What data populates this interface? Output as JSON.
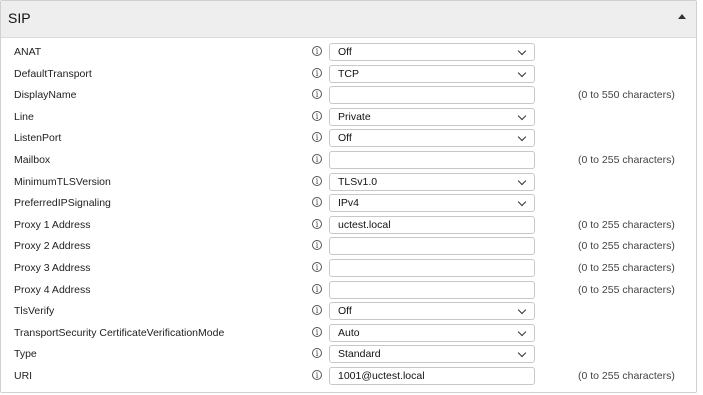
{
  "panel": {
    "title": "SIP"
  },
  "rows": [
    {
      "label": "ANAT",
      "type": "select",
      "value": "Off",
      "hint": ""
    },
    {
      "label": "DefaultTransport",
      "type": "select",
      "value": "TCP",
      "hint": ""
    },
    {
      "label": "DisplayName",
      "type": "text",
      "value": "",
      "hint": "(0 to 550 characters)"
    },
    {
      "label": "Line",
      "type": "select",
      "value": "Private",
      "hint": ""
    },
    {
      "label": "ListenPort",
      "type": "select",
      "value": "Off",
      "hint": ""
    },
    {
      "label": "Mailbox",
      "type": "text",
      "value": "",
      "hint": "(0 to 255 characters)"
    },
    {
      "label": "MinimumTLSVersion",
      "type": "select",
      "value": "TLSv1.0",
      "hint": ""
    },
    {
      "label": "PreferredIPSignaling",
      "type": "select",
      "value": "IPv4",
      "hint": ""
    },
    {
      "label": "Proxy 1 Address",
      "type": "text",
      "value": "uctest.local",
      "hint": "(0 to 255 characters)"
    },
    {
      "label": "Proxy 2 Address",
      "type": "text",
      "value": "",
      "hint": "(0 to 255 characters)"
    },
    {
      "label": "Proxy 3 Address",
      "type": "text",
      "value": "",
      "hint": "(0 to 255 characters)"
    },
    {
      "label": "Proxy 4 Address",
      "type": "text",
      "value": "",
      "hint": "(0 to 255 characters)"
    },
    {
      "label": "TlsVerify",
      "type": "select",
      "value": "Off",
      "hint": ""
    },
    {
      "label": "TransportSecurity CertificateVerificationMode",
      "type": "select",
      "value": "Auto",
      "hint": ""
    },
    {
      "label": "Type",
      "type": "select",
      "value": "Standard",
      "hint": ""
    },
    {
      "label": "URI",
      "type": "text",
      "value": "1001@uctest.local",
      "hint": "(0 to 255 characters)"
    }
  ],
  "icons": {
    "info": "info-icon",
    "collapse": "collapse-up-icon"
  },
  "info_glyph": "i"
}
